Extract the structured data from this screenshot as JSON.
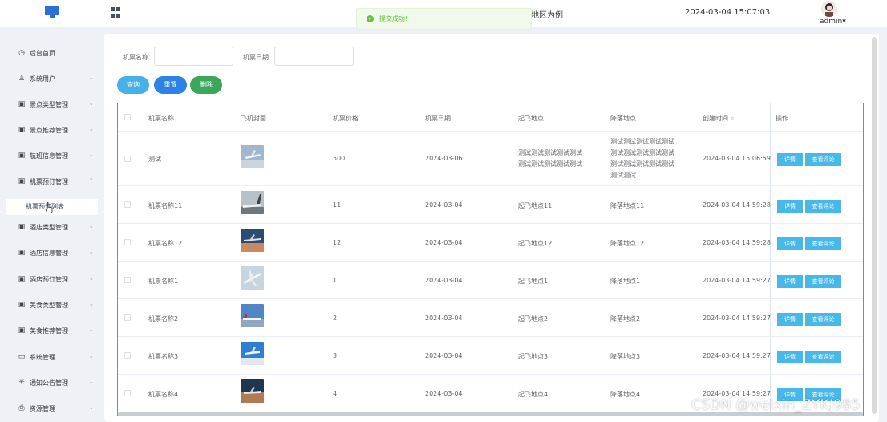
{
  "header": {
    "title": "地区为例",
    "datetime": "2024-03-04 15:07:03",
    "user": "admin",
    "user_caret": "▾"
  },
  "toast": {
    "message": "提交成功!",
    "icon": "check-circle-icon",
    "color": "#67c23a"
  },
  "sidebar": {
    "items": [
      {
        "label": "后台首页",
        "icon": "clock-icon"
      },
      {
        "label": "系统用户",
        "icon": "user-icon"
      },
      {
        "label": "景点类型管理",
        "icon": "picture-icon"
      },
      {
        "label": "景点推荐管理",
        "icon": "picture-icon"
      },
      {
        "label": "航班信息管理",
        "icon": "picture-icon"
      },
      {
        "label": "机票预订管理",
        "icon": "picture-icon"
      },
      {
        "label": "酒店类型管理",
        "icon": "picture-icon"
      },
      {
        "label": "酒店信息管理",
        "icon": "picture-icon"
      },
      {
        "label": "酒店预订管理",
        "icon": "picture-icon"
      },
      {
        "label": "美食类型管理",
        "icon": "picture-icon"
      },
      {
        "label": "美食推荐管理",
        "icon": "picture-icon"
      },
      {
        "label": "系统管理",
        "icon": "folder-icon"
      },
      {
        "label": "通知公告管理",
        "icon": "loading-icon"
      },
      {
        "label": "资源管理",
        "icon": "printer-icon"
      }
    ],
    "sub_item": "机票预订列表"
  },
  "search": {
    "name_label": "机票名称",
    "name_value": "",
    "date_label": "机票日期",
    "date_value": "",
    "query_label": "查询",
    "reset_label": "重置",
    "delete_label": "删除"
  },
  "table": {
    "headers": [
      "机票名称",
      "飞机封面",
      "机票价格",
      "机票日期",
      "起飞地点",
      "降落地点",
      "创建时间",
      "操作"
    ],
    "detail_label": "详情",
    "comment_label": "查看评论",
    "rows": [
      {
        "name": "测试",
        "price": "500",
        "date": "2024-03-06",
        "from": "测试测试测试测试测试\n测试测试测试测试测试",
        "to": "测试测试测试测试测试\n测试测试测试测试测试\n测试测试测试测试测试\n测试测试",
        "created": "2024-03-04 15:06:59",
        "cover": "plane-sky"
      },
      {
        "name": "机票名称11",
        "price": "11",
        "date": "2024-03-04",
        "from": "起飞地点11",
        "to": "降落地点11",
        "created": "2024-03-04 14:59:28",
        "cover": "plane-ground"
      },
      {
        "name": "机票名称12",
        "price": "12",
        "date": "2024-03-04",
        "from": "起飞地点12",
        "to": "降落地点12",
        "created": "2024-03-04 14:59:28",
        "cover": "plane-dusk"
      },
      {
        "name": "机票名称1",
        "price": "1",
        "date": "2024-03-04",
        "from": "起飞地点1",
        "to": "降落地点1",
        "created": "2024-03-04 14:59:27",
        "cover": "plane-light"
      },
      {
        "name": "机票名称2",
        "price": "2",
        "date": "2024-03-04",
        "from": "起飞地点2",
        "to": "降落地点2",
        "created": "2024-03-04 14:59:27",
        "cover": "plane-runway"
      },
      {
        "name": "机票名称3",
        "price": "3",
        "date": "2024-03-04",
        "from": "起飞地点3",
        "to": "降落地点3",
        "created": "2024-03-04 14:59:27",
        "cover": "plane-blue"
      },
      {
        "name": "机票名称4",
        "price": "4",
        "date": "2024-03-04",
        "from": "起飞地点4",
        "to": "降落地点4",
        "created": "2024-03-04 14:59:27",
        "cover": "plane-sunset"
      }
    ]
  },
  "watermark": "CSDN @weixin_ZYKJ985"
}
